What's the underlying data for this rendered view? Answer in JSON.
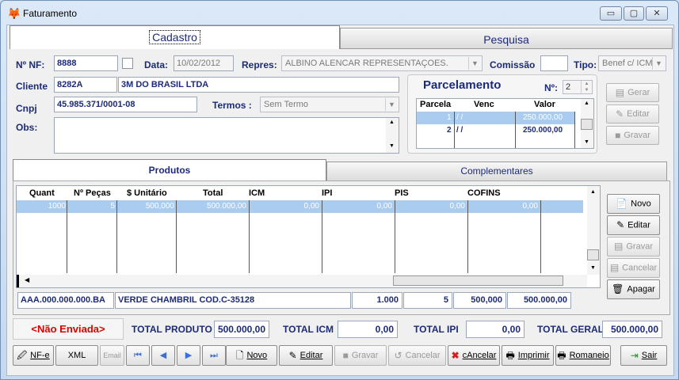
{
  "window": {
    "title": "Faturamento",
    "min": "▭",
    "max": "▢",
    "close": "✕"
  },
  "tabs": {
    "cadastro": "Cadastro",
    "pesquisa": "Pesquisa"
  },
  "header": {
    "nf_label": "Nº NF:",
    "nf_value": "8888",
    "data_label": "Data:",
    "data_value": "10/02/2012",
    "repres_label": "Repres:",
    "repres_value": "ALBINO ALENCAR REPRESENTAÇOES.",
    "comissao_label": "Comissão",
    "comissao_value": "",
    "tipo_label": "Tipo:",
    "tipo_value": "Benef c/ ICM",
    "cliente_label": "Cliente",
    "cliente_code": "8282A",
    "cliente_name": "3M DO BRASIL LTDA",
    "cnpj_label": "Cnpj",
    "cnpj_value": "45.985.371/0001-08",
    "termos_label": "Termos :",
    "termos_value": "Sem Termo",
    "obs_label": "Obs:"
  },
  "parcelamento": {
    "title": "Parcelamento",
    "n_label": "Nº:",
    "n_value": "2",
    "columns": [
      "Parcela",
      "Venc",
      "Valor"
    ],
    "rows": [
      {
        "parcela": "1",
        "venc": "/  /",
        "valor": "250.000,00"
      },
      {
        "parcela": "2",
        "venc": "/  /",
        "valor": "250.000,00"
      }
    ],
    "gerar": "Gerar",
    "editar": "Editar",
    "gravar": "Gravar"
  },
  "products_tabs": {
    "produtos": "Produtos",
    "complementares": "Complementares"
  },
  "products": {
    "columns": [
      "Quant",
      "Nº Peças",
      "$ Unitário",
      "Total",
      "ICM",
      "IPI",
      "PIS",
      "COFINS"
    ],
    "row": {
      "quant": "1000",
      "pecas": "5",
      "unit": "500,000",
      "total": "500.000,00",
      "icm": "0,00",
      "ipi": "0,00",
      "pis": "0,00",
      "cofins": "0,00"
    },
    "detail": {
      "codigo": "AAA.000.000.000.BA",
      "descricao": "VERDE CHAMBRIL COD.C-35128",
      "quant": "1.000",
      "pecas": "5",
      "unit": "500,000",
      "total": "500.000,00"
    },
    "buttons": {
      "novo": "Novo",
      "editar": "Editar",
      "gravar": "Gravar",
      "cancelar": "Cancelar",
      "apagar": "Apagar"
    }
  },
  "totals": {
    "status": "<Não Enviada>",
    "produto_label": "TOTAL PRODUTO",
    "produto_value": "500.000,00",
    "icm_label": "TOTAL ICM",
    "icm_value": "0,00",
    "ipi_label": "TOTAL IPI",
    "ipi_value": "0,00",
    "geral_label": "TOTAL GERAL",
    "geral_value": "500.000,00"
  },
  "toolbar": {
    "nfe": "NF-e",
    "xml": "XML",
    "email": "Email",
    "novo": "Novo",
    "editar": "Editar",
    "gravar": "Gravar",
    "cancelar": "Cancelar",
    "cancelar_accel": "cAncelar",
    "imprimir": "Imprimir",
    "romaneio": "Romaneio",
    "sair": "Sair"
  },
  "colors": {
    "label": "#1c2a7a",
    "selection": "#a9ccef",
    "status": "#e00000",
    "window_bg": "#f0f0f0"
  }
}
